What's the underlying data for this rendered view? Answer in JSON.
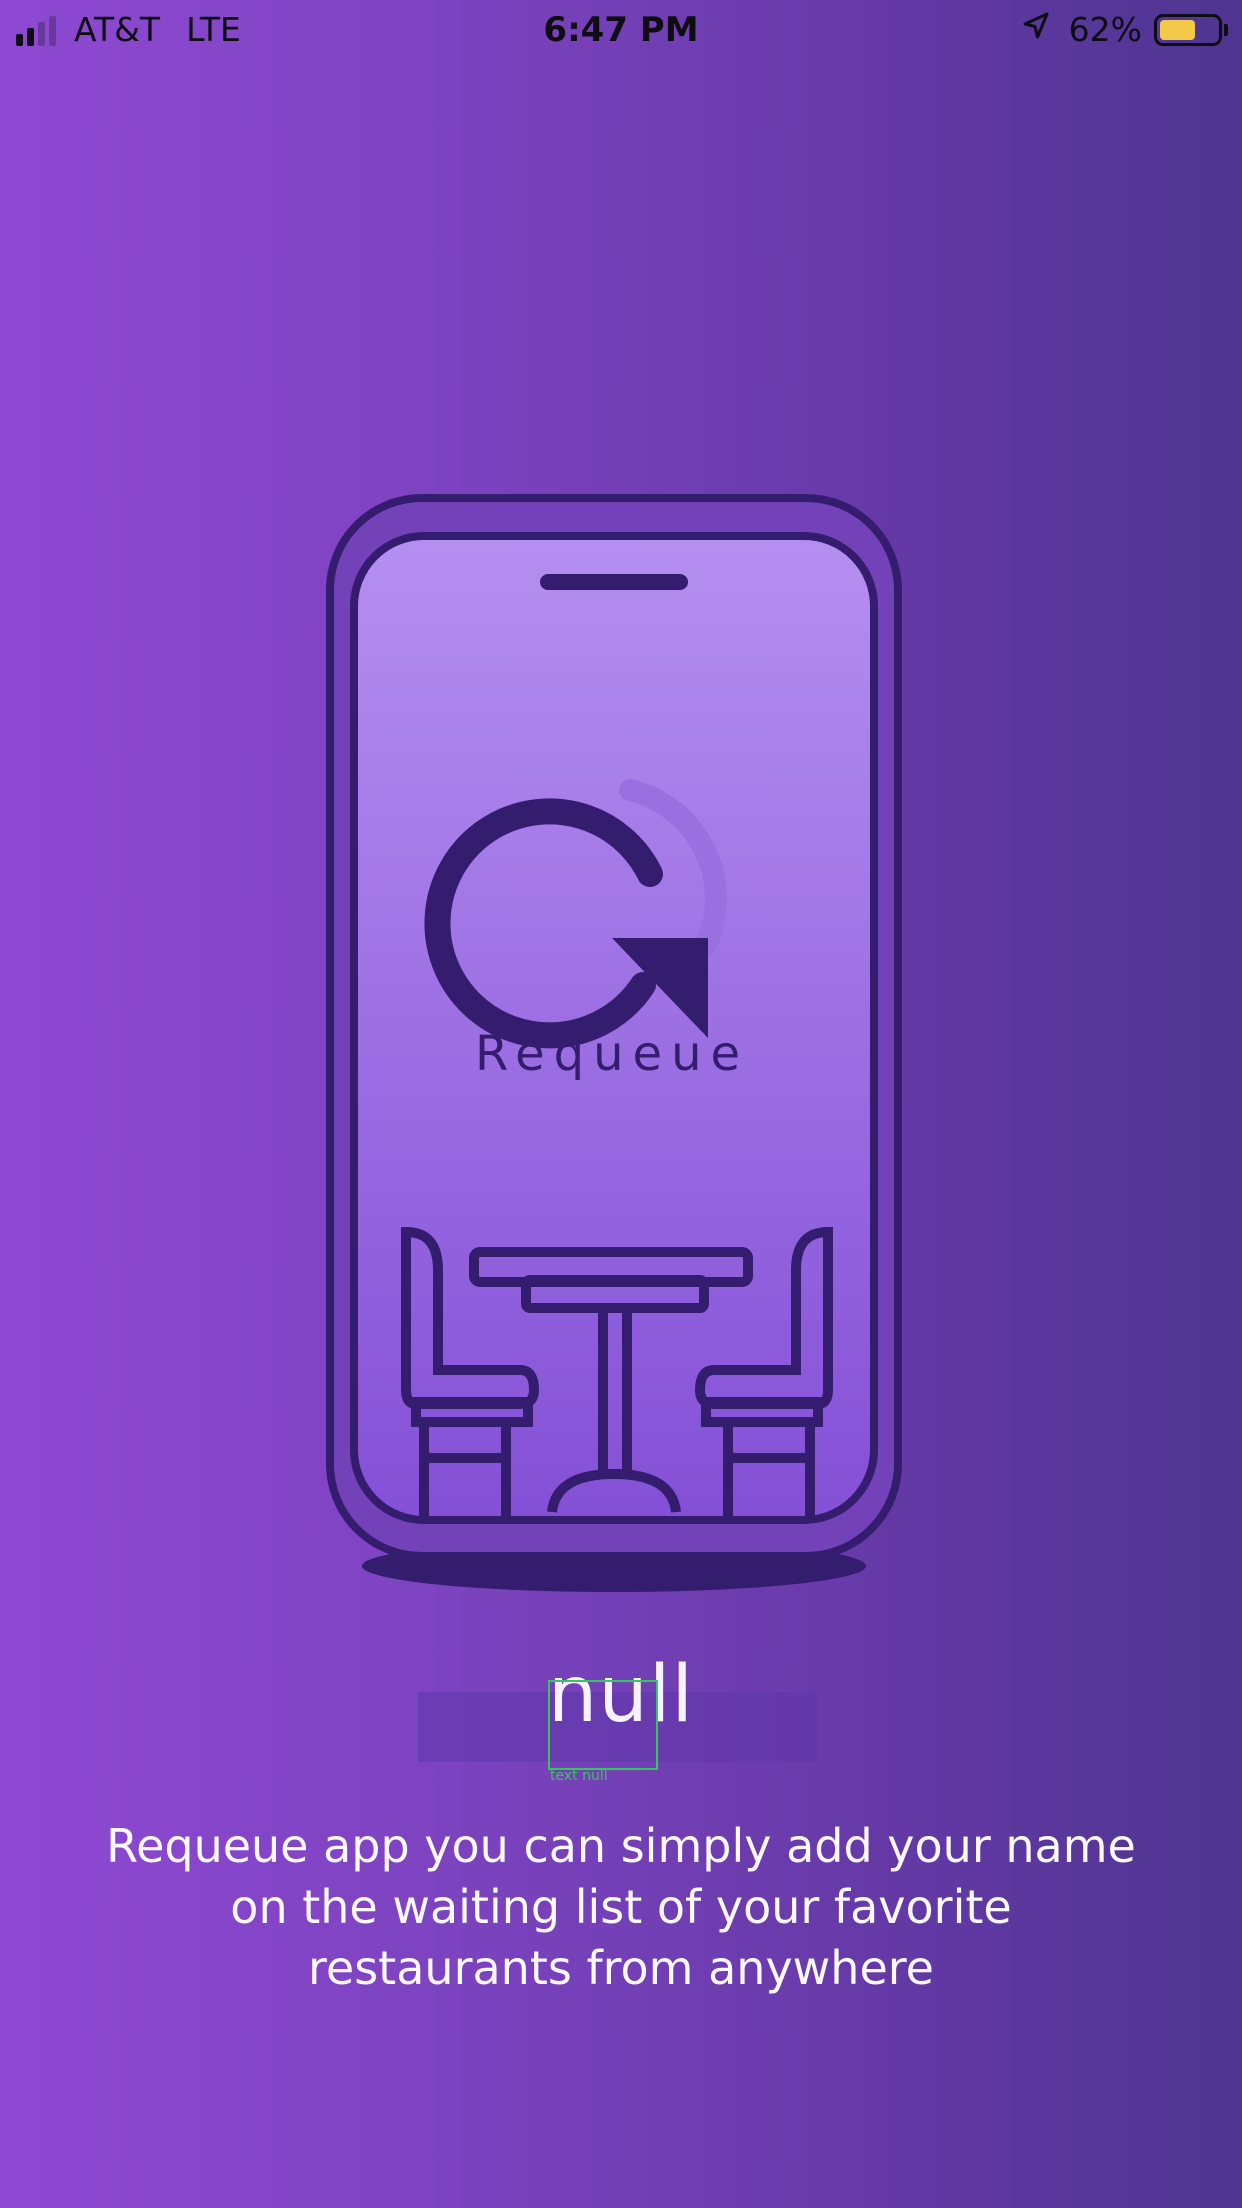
{
  "status_bar": {
    "carrier": "AT&T",
    "network": "LTE",
    "time": "6:47 PM",
    "battery_percent": "62%",
    "battery_level": 0.62,
    "icons": [
      "signal-icon",
      "location-arrow-icon",
      "battery-icon"
    ]
  },
  "illustration": {
    "logo_text": "Requeue",
    "icons": [
      "phone-outline-icon",
      "requeue-logo-icon",
      "table-icon",
      "chair-icon"
    ]
  },
  "onboarding": {
    "headline": "null",
    "description_lines": [
      "Requeue app you can simply add your name",
      "on the waiting list of your favorite",
      "restaurants from anywhere"
    ]
  },
  "debug_overlay": {
    "label": "text null"
  },
  "colors": {
    "background_left": "#8f49d4",
    "background_right": "#4e3590",
    "illustration_stroke": "#341c6e",
    "screen_top": "#b48ff0",
    "screen_bottom": "#8450d6",
    "battery_fill": "#f3c94a",
    "debug_outline": "#34c759"
  }
}
